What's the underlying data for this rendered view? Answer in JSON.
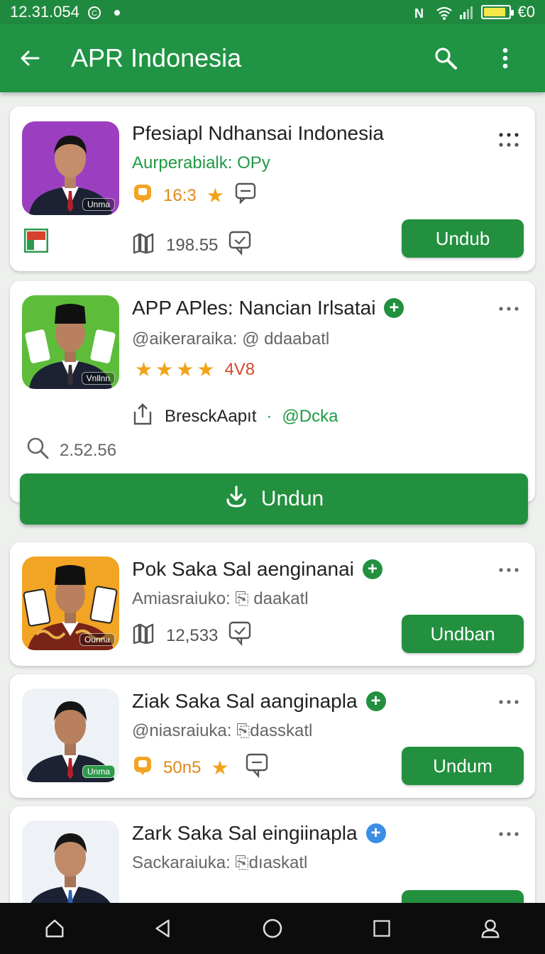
{
  "status_bar": {
    "time": "12.31.054",
    "battery_text": "€0",
    "battery_level": 0.9
  },
  "app_bar": {
    "title": "APR Indonesia"
  },
  "cards": [
    {
      "title": "Pfesiapl Ndhansai Indonesia",
      "subtitle": "Aurperabialk: OPy",
      "rating": "16:3",
      "count": "198.55",
      "thumb_tag": "Unma",
      "thumb_bg": "#9b3fc0",
      "button": "Undub"
    },
    {
      "title": "APP APles: Nancian Irlsatai",
      "subtitle": "@aikeraraika: @ ddaabatl",
      "rating": "4V8",
      "stars": 4,
      "dev": "BresckAapıt",
      "dev_tag": "@Dcka",
      "count": "2.52.56",
      "thumb_tag": "Vnllnn",
      "thumb_bg": "#5dbd3a",
      "button": "Undun"
    },
    {
      "title": "Pok Saka Sal aenginanai",
      "subtitle": "Amiasraiuko: ⎘ daakatl",
      "count": "12,533",
      "thumb_tag": "Ounna",
      "thumb_bg": "#f2a425",
      "button": "Undban"
    },
    {
      "title": "Ziak Saka Sal aanginapla",
      "subtitle": "@niasraiuka: ⎘dasskatl",
      "rating": "50n5",
      "thumb_tag": "Unma",
      "thumb_bg": "#eef2f6",
      "button": "Undum"
    },
    {
      "title": "Zark Saka Sal eingiinapla",
      "subtitle": "Sackaraiuka: ⎘dıaskatl",
      "thumb_bg": "#eef2f6"
    }
  ],
  "colors": {
    "primary": "#209444",
    "button": "#22903f",
    "accent_orange": "#e0891a",
    "star": "#f0a31a",
    "badge_blue": "#3a8ee6"
  },
  "icons": [
    "back-arrow-icon",
    "search-icon",
    "overflow-menu-icon",
    "more-horiz-icon",
    "download-icon",
    "home-icon",
    "back-triangle-icon",
    "circle-home-icon",
    "recents-icon",
    "profile-icon"
  ]
}
